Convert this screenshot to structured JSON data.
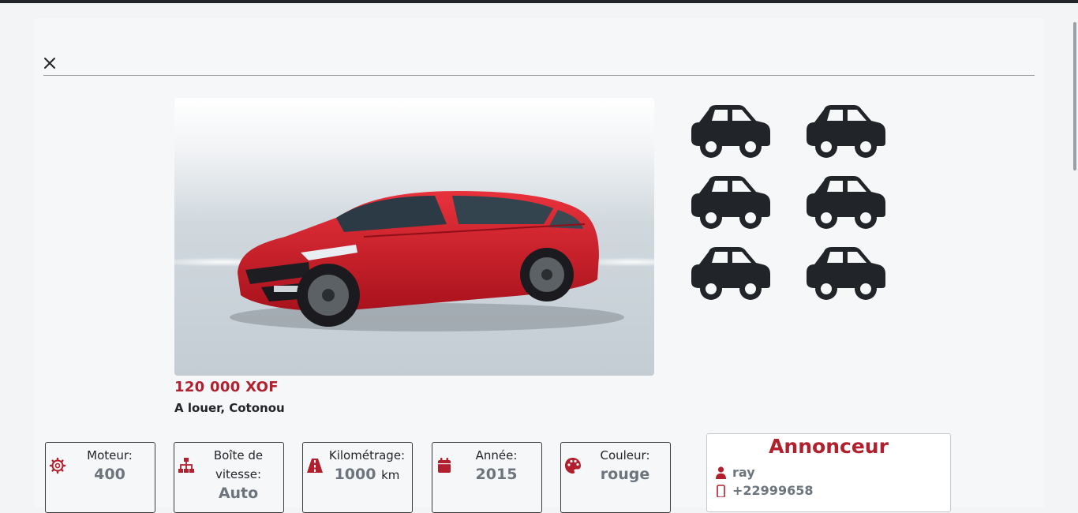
{
  "modal": {
    "close_icon": "close-icon"
  },
  "listing": {
    "price": "120 000 XOF",
    "location": "A louer, Cotonou",
    "photo": "red-hatchback-car-photo",
    "thumbnails": [
      "car-icon",
      "car-icon",
      "car-icon",
      "car-icon",
      "car-icon",
      "car-icon"
    ]
  },
  "specs": [
    {
      "icon": "gear-icon",
      "label": "Moteur:",
      "value": "400",
      "unit": ""
    },
    {
      "icon": "sitemap-icon",
      "label": "Boîte de vitesse:",
      "value": "Auto",
      "unit": ""
    },
    {
      "icon": "road-icon",
      "label": "Kilométrage:",
      "value": "1000",
      "unit": "km"
    },
    {
      "icon": "calendar-icon",
      "label": "Année:",
      "value": "2015",
      "unit": ""
    },
    {
      "icon": "palette-icon",
      "label": "Couleur:",
      "value": "rouge",
      "unit": ""
    }
  ],
  "announcer": {
    "title": "Annonceur",
    "name": "ray",
    "phone": "+22999658"
  },
  "colors": {
    "accent": "#b21f2d",
    "muted": "#6c757d",
    "icon_dark": "#212529"
  }
}
